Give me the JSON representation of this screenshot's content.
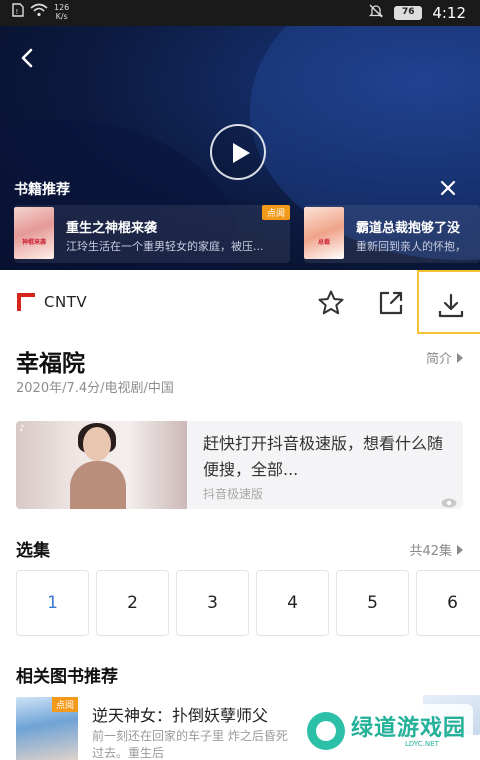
{
  "status_bar": {
    "net_speed": "126",
    "net_unit": "K/s",
    "battery": "76",
    "time": "4:12"
  },
  "video": {
    "book_recommend_title": "书籍推荐",
    "books": [
      {
        "name": "重生之神棍来袭",
        "desc": "江玲生活在一个重男轻女的家庭，被压...",
        "badge": "点阅",
        "cover_text": "神棍来袭"
      },
      {
        "name": "霸道总裁抱够了没",
        "desc": "重新回到亲人的怀抱，",
        "cover_text": "总裁"
      }
    ]
  },
  "source": {
    "name": "CNTV"
  },
  "show": {
    "title": "幸福院",
    "intro_link": "简介",
    "meta": "2020年/7.4分/电视剧/中国"
  },
  "ad": {
    "text": "赶快打开抖音极速版，想看什么随便搜，全部...",
    "source": "抖音极速版"
  },
  "episodes": {
    "title": "选集",
    "total": "共42集",
    "items": [
      "1",
      "2",
      "3",
      "4",
      "5",
      "6"
    ],
    "active_index": 0
  },
  "related": {
    "title": "相关图书推荐",
    "book_name": "逆天神女：扑倒妖孽师父",
    "book_desc": "前一刻还在回家的车子里 炸之后昏死过去。重生后",
    "badge": "点阅"
  },
  "watermark": {
    "name": "绿道游戏园",
    "url": "LDYC.NET"
  },
  "colors": {
    "accent": "#3a7bd5",
    "badge": "#f39a1b",
    "download_highlight": "#f2c233",
    "cntv_red": "#d6251d"
  }
}
